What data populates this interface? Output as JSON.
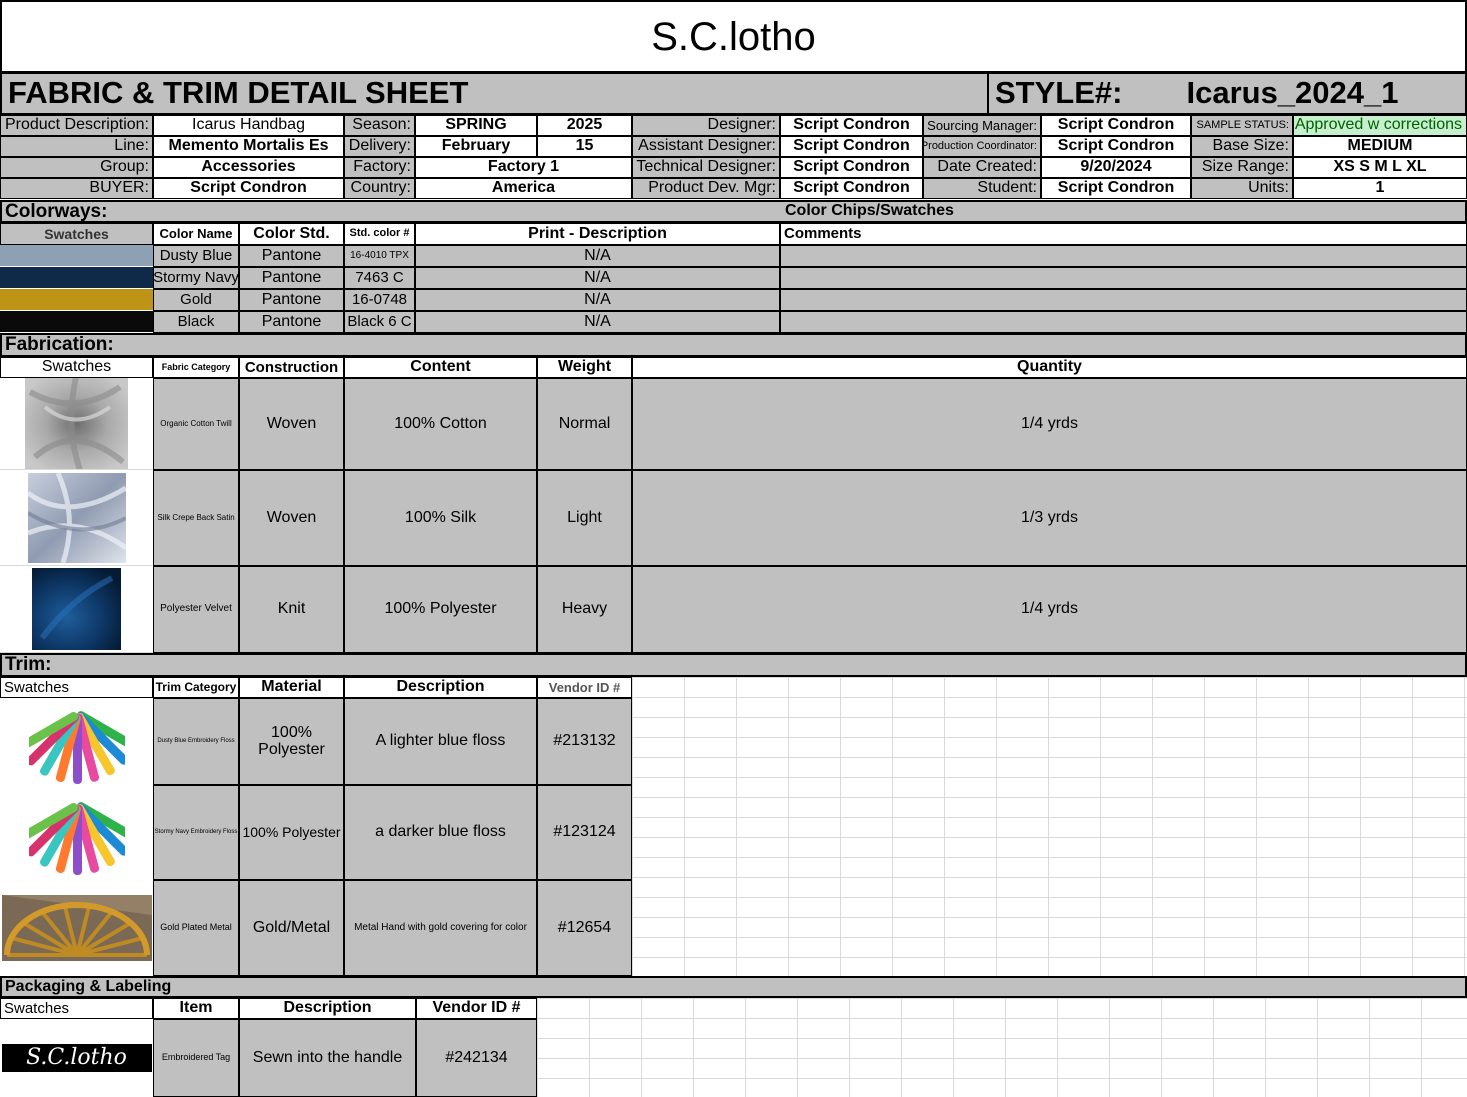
{
  "brand": "S.C.lotho",
  "sheet_title": "FABRIC & TRIM DETAIL SHEET",
  "style_label": "STYLE#:",
  "style_value": "Icarus_2024_1",
  "header": {
    "product_description_label": "Product Description:",
    "product_description": "Icarus Handbag",
    "line_label": "Line:",
    "line": "Memento Mortalis Es",
    "group_label": "Group:",
    "group": "Accessories",
    "buyer_label": "BUYER:",
    "buyer": "Script Condron",
    "season_label": "Season:",
    "season": "SPRING",
    "season_year": "2025",
    "delivery_label": "Delivery:",
    "delivery_month": "February",
    "delivery_day": "15",
    "factory_label": "Factory:",
    "factory": "Factory 1",
    "country_label": "Country:",
    "country": "America",
    "designer_label": "Designer:",
    "designer": "Script Condron",
    "assistant_designer_label": "Assistant Designer:",
    "assistant_designer": "Script Condron",
    "technical_designer_label": "Technical Designer:",
    "technical_designer": "Script Condron",
    "product_dev_mgr_label": "Product Dev. Mgr:",
    "product_dev_mgr": "Script Condron",
    "sourcing_manager_label": "Sourcing Manager:",
    "sourcing_manager": "Script Condron",
    "production_coordinator_label": "Production Coordinator:",
    "production_coordinator": "Script Condron",
    "date_created_label": "Date Created:",
    "date_created": "9/20/2024",
    "student_label": "Student:",
    "student": "Script Condron",
    "sample_status_label": "SAMPLE STATUS:",
    "sample_status": "Approved w corrections",
    "base_size_label": "Base Size:",
    "base_size": "MEDIUM",
    "size_range_label": "Size Range:",
    "size_range": "XS S M L XL",
    "units_label": "Units:",
    "units": "1"
  },
  "colorways": {
    "section_title": "Colorways:",
    "chips_title": "Color Chips/Swatches",
    "headers": {
      "swatches": "Swatches",
      "color_name": "Color Name",
      "color_std": "Color Std.",
      "std_color_no": "Std. color #",
      "print_desc": "Print - Description",
      "comments": "Comments"
    },
    "rows": [
      {
        "color": "#8ea0b3",
        "name": "Dusty Blue",
        "std": "Pantone",
        "code": "16-4010 TPX",
        "print": "N/A"
      },
      {
        "color": "#0e2a48",
        "name": "Stormy Navy",
        "std": "Pantone",
        "code": "7463 C",
        "print": "N/A"
      },
      {
        "color": "#be9417",
        "name": "Gold",
        "std": "Pantone",
        "code": "16-0748",
        "print": "N/A"
      },
      {
        "color": "#0a0a0a",
        "name": "Black",
        "std": "Pantone",
        "code": "Black 6 C",
        "print": "N/A"
      }
    ]
  },
  "fabrication": {
    "section_title": "Fabrication:",
    "headers": {
      "swatches": "Swatches",
      "category": "Fabric Category",
      "construction": "Construction",
      "content": "Content",
      "weight": "Weight",
      "quantity": "Quantity"
    },
    "rows": [
      {
        "swatch": "gray-cotton-twill-swatch",
        "category": "Organic Cotton Twill",
        "construction": "Woven",
        "content": "100% Cotton",
        "weight": "Normal",
        "quantity": "1/4 yrds"
      },
      {
        "swatch": "silk-satin-swatch",
        "category": "Silk Crepe Back Satin",
        "construction": "Woven",
        "content": "100% Silk",
        "weight": "Light",
        "quantity": "1/3 yrds"
      },
      {
        "swatch": "blue-velvet-swatch",
        "category": "Polyester Velvet",
        "construction": "Knit",
        "content": "100% Polyester",
        "weight": "Heavy",
        "quantity": "1/4 yrds"
      }
    ]
  },
  "trim": {
    "section_title": "Trim:",
    "headers": {
      "swatches": "Swatches",
      "category": "Trim Category",
      "material": "Material",
      "description": "Description",
      "vendor_id": "Vendor ID #"
    },
    "rows": [
      {
        "swatch": "embroidery-floss-swatch",
        "category": "Dusty Blue Embroidery Floss",
        "material": "100% Polyester",
        "description": "A lighter blue floss",
        "vendor_id": "#213132"
      },
      {
        "swatch": "embroidery-floss-swatch",
        "category": "Stormy Navy Embroidery Floss",
        "material": "100% Polyester",
        "description": "a darker blue floss",
        "vendor_id": "#123124"
      },
      {
        "swatch": "gold-metal-handle-swatch",
        "category": "Gold Plated Metal",
        "material": "Gold/Metal",
        "description": "Metal Hand with gold covering for color",
        "vendor_id": "#12654"
      }
    ]
  },
  "packaging": {
    "section_title": "Packaging & Labeling",
    "headers": {
      "swatches": "Swatches",
      "item": "Item",
      "description": "Description",
      "vendor_id": "Vendor ID #"
    },
    "rows": [
      {
        "label_text": "S.C.lotho",
        "item": "Embroidered Tag",
        "description": "Sewn into the handle",
        "vendor_id": "#242134"
      }
    ]
  }
}
